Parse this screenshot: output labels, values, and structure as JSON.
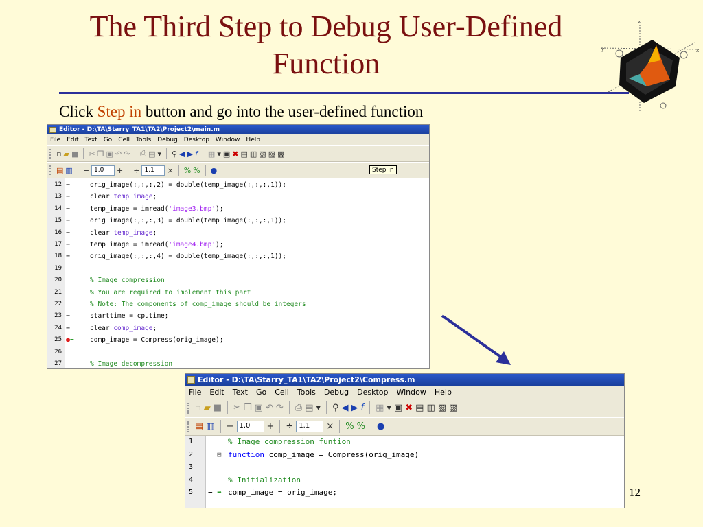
{
  "slide": {
    "title": "The Third Step to Debug User-Defined Function",
    "subtitle_prefix": "Click ",
    "subtitle_highlight": "Step in",
    "subtitle_suffix": " button and go into the user-defined function",
    "page_number": "12"
  },
  "colors": {
    "title": "#7a1010",
    "rule": "#2b2f9a",
    "highlight": "#c04000",
    "background": "#fffbd8"
  },
  "menu_items": [
    "File",
    "Edit",
    "Text",
    "Go",
    "Cell",
    "Tools",
    "Debug",
    "Desktop",
    "Window",
    "Help"
  ],
  "cell_toolbar": {
    "decrement": "−",
    "increment": "+",
    "divide": "÷",
    "multiply": "×",
    "value1": "1.0",
    "value2": "1.1"
  },
  "editor1": {
    "title": "Editor - D:\\TA\\Starry_TA1\\TA2\\Project2\\main.m",
    "tooltip": "Step in",
    "lines": [
      {
        "num": "12",
        "mark": "−",
        "segments": [
          {
            "t": "orig_image(:,:,:,2) = double(temp_image(:,:,:,1));",
            "c": "c-plain"
          }
        ]
      },
      {
        "num": "13",
        "mark": "−",
        "segments": [
          {
            "t": "clear ",
            "c": "c-plain"
          },
          {
            "t": "temp_image",
            "c": "c-var"
          },
          {
            "t": ";",
            "c": "c-plain"
          }
        ]
      },
      {
        "num": "14",
        "mark": "−",
        "segments": [
          {
            "t": "temp_image = imread(",
            "c": "c-plain"
          },
          {
            "t": "'image3.bmp'",
            "c": "c-string"
          },
          {
            "t": ");",
            "c": "c-plain"
          }
        ]
      },
      {
        "num": "15",
        "mark": "−",
        "segments": [
          {
            "t": "orig_image(:,:,:,3) = double(temp_image(:,:,:,1));",
            "c": "c-plain"
          }
        ]
      },
      {
        "num": "16",
        "mark": "−",
        "segments": [
          {
            "t": "clear ",
            "c": "c-plain"
          },
          {
            "t": "temp_image",
            "c": "c-var"
          },
          {
            "t": ";",
            "c": "c-plain"
          }
        ]
      },
      {
        "num": "17",
        "mark": "−",
        "segments": [
          {
            "t": "temp_image = imread(",
            "c": "c-plain"
          },
          {
            "t": "'image4.bmp'",
            "c": "c-string"
          },
          {
            "t": ");",
            "c": "c-plain"
          }
        ]
      },
      {
        "num": "18",
        "mark": "−",
        "segments": [
          {
            "t": "orig_image(:,:,:,4) = double(temp_image(:,:,:,1));",
            "c": "c-plain"
          }
        ]
      },
      {
        "num": "19",
        "mark": "",
        "segments": []
      },
      {
        "num": "20",
        "mark": "",
        "segments": [
          {
            "t": "% Image compression",
            "c": "c-comment"
          }
        ]
      },
      {
        "num": "21",
        "mark": "",
        "segments": [
          {
            "t": "% You are required to implement this part",
            "c": "c-comment"
          }
        ]
      },
      {
        "num": "22",
        "mark": "",
        "segments": [
          {
            "t": "% Note: The components of comp_image should be integers",
            "c": "c-comment"
          }
        ]
      },
      {
        "num": "23",
        "mark": "−",
        "segments": [
          {
            "t": "starttime = cputime;",
            "c": "c-plain"
          }
        ]
      },
      {
        "num": "24",
        "mark": "−",
        "segments": [
          {
            "t": "clear ",
            "c": "c-plain"
          },
          {
            "t": "comp_image",
            "c": "c-var"
          },
          {
            "t": ";",
            "c": "c-plain"
          }
        ]
      },
      {
        "num": "25",
        "mark": "bp",
        "segments": [
          {
            "t": "comp_image = Compress(orig_image);",
            "c": "c-plain"
          }
        ]
      },
      {
        "num": "26",
        "mark": "",
        "segments": []
      },
      {
        "num": "27",
        "mark": "",
        "segments": [
          {
            "t": "% Image decompression",
            "c": "c-comment"
          }
        ]
      }
    ]
  },
  "editor2": {
    "title": "Editor - D:\\TA\\Starry_TA1\\TA2\\Project2\\Compress.m",
    "lines": [
      {
        "num": "1",
        "mark": "",
        "segments": [
          {
            "t": "% Image compression funtion",
            "c": "c-comment"
          }
        ]
      },
      {
        "num": "2",
        "mark": "fold",
        "segments": [
          {
            "t": "function",
            "c": "c-kw"
          },
          {
            "t": " comp_image = Compress(orig_image)",
            "c": "c-plain"
          }
        ]
      },
      {
        "num": "3",
        "mark": "",
        "segments": []
      },
      {
        "num": "4",
        "mark": "",
        "segments": [
          {
            "t": "% Initialization",
            "c": "c-comment"
          }
        ]
      },
      {
        "num": "5",
        "mark": "cur",
        "segments": [
          {
            "t": "comp_image = orig_image;",
            "c": "c-plain"
          }
        ]
      }
    ]
  }
}
